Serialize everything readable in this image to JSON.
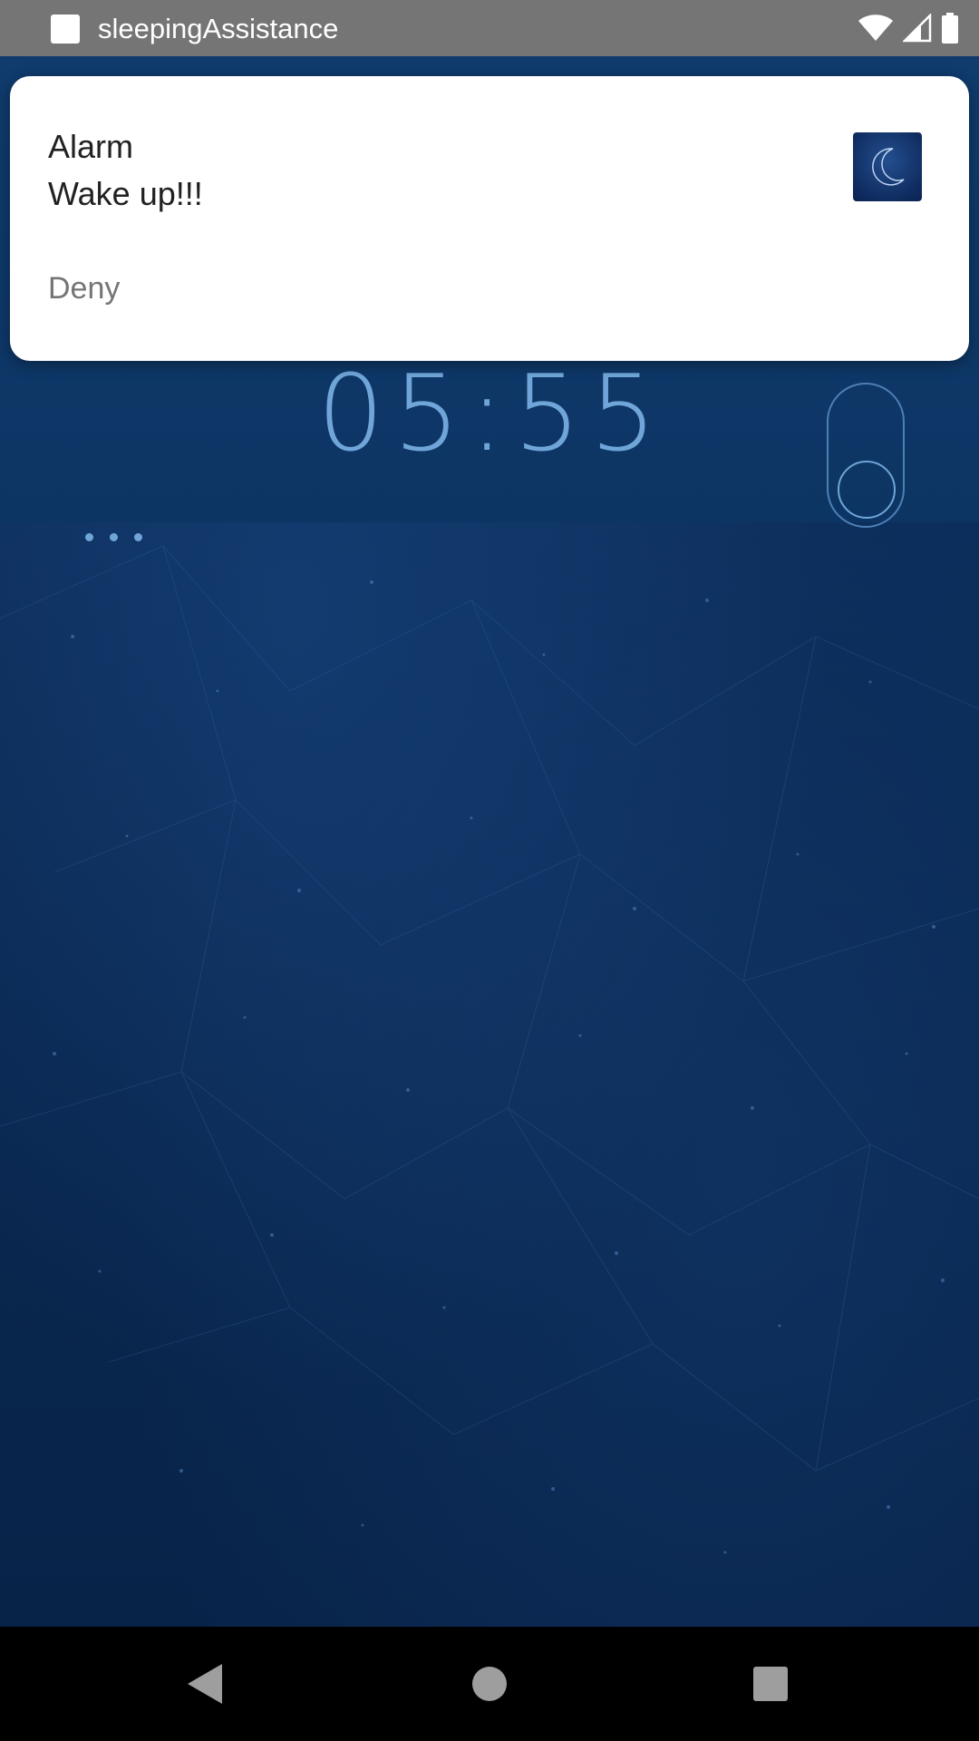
{
  "status_bar": {
    "app_title": "sleepingAssistance",
    "icons": [
      "app-notification-icon",
      "wifi-icon",
      "cell-signal-icon",
      "battery-icon"
    ],
    "background_color": "#757575"
  },
  "notification": {
    "title": "Alarm",
    "text": "Wake up!!!",
    "action_label": "Deny",
    "large_icon": "moon-icon"
  },
  "app": {
    "clock_time": "05:55",
    "more_menu_icon": "more-dots-icon",
    "toggle_icon": "sleep-toggle",
    "background_color": "#0b2c57",
    "accent_color": "#6fa5d8"
  },
  "nav_bar": {
    "buttons": [
      "back-icon",
      "home-icon",
      "recents-icon"
    ]
  }
}
